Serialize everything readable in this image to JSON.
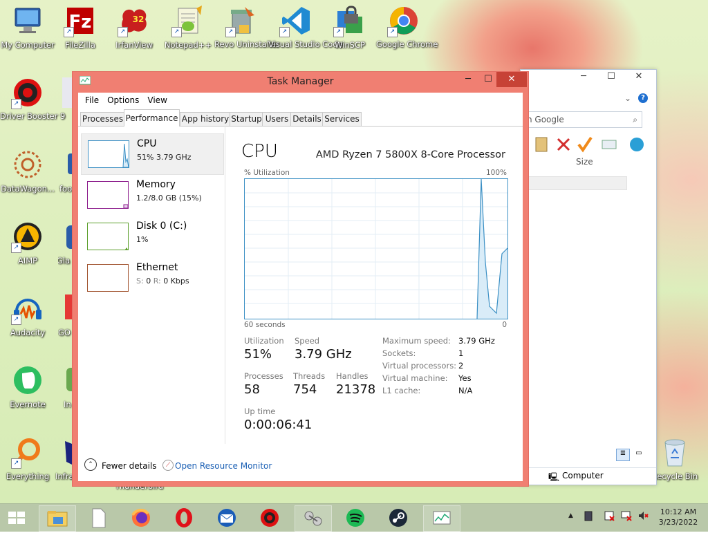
{
  "desktop": {
    "icons": [
      {
        "label": "My Computer",
        "icon": "computer-icon"
      },
      {
        "label": "FileZilla",
        "icon": "filezilla-icon"
      },
      {
        "label": "IrfanView",
        "icon": "irfanview-icon",
        "badge": "32"
      },
      {
        "label": "Notepad++",
        "icon": "notepad-plus-plus-icon"
      },
      {
        "label": "Revo Uninstaller",
        "icon": "revo-uninstaller-icon"
      },
      {
        "label": "Visual Studio Code",
        "icon": "vscode-icon"
      },
      {
        "label": "WinSCP",
        "icon": "winscp-icon"
      },
      {
        "label": "Google Chrome",
        "icon": "chrome-icon"
      },
      {
        "label": "Driver Booster 9",
        "icon": "driver-booster-icon"
      },
      {
        "label": "DataWagon...",
        "icon": "datawagon-icon"
      },
      {
        "label": "AIMP",
        "icon": "aimp-icon"
      },
      {
        "label": "Audacity",
        "icon": "audacity-icon"
      },
      {
        "label": "Evernote",
        "icon": "evernote-icon"
      },
      {
        "label": "Everything",
        "icon": "everything-icon"
      },
      {
        "label": "Recycle Bin",
        "icon": "recycle-bin-icon"
      }
    ],
    "partial_labels": {
      "col2_row2": "F",
      "col2_row3": "foo",
      "col2_row4": "Gla",
      "col2_row5": "GO",
      "col2_row6": "In",
      "col2_row7": "Infra",
      "thunderbird": "Thunderbird"
    }
  },
  "background_window": {
    "search_placeholder": "h Google",
    "column_size": "Size",
    "status_item": "Computer"
  },
  "task_manager": {
    "title": "Task Manager",
    "menu": [
      "File",
      "Options",
      "View"
    ],
    "tabs": [
      "Processes",
      "Performance",
      "App history",
      "Startup",
      "Users",
      "Details",
      "Services"
    ],
    "active_tab": "Performance",
    "resources": [
      {
        "name": "CPU",
        "detail": "51% 3.79 GHz",
        "color": "#3a8fc4"
      },
      {
        "name": "Memory",
        "detail": "1.2/8.0 GB (15%)",
        "color": "#8b1a8b"
      },
      {
        "name": "Disk 0 (C:)",
        "detail": "1%",
        "color": "#5a9e2a"
      },
      {
        "name": "Ethernet",
        "detail_parts": [
          "S:",
          "0",
          "R:",
          "0 Kbps"
        ],
        "color": "#a0522d"
      }
    ],
    "cpu": {
      "heading": "CPU",
      "model": "AMD Ryzen 7 5800X 8-Core Processor",
      "util_label": "% Utilization",
      "max_label": "100%",
      "time_label": "60 seconds",
      "min_label": "0",
      "utilization_label": "Utilization",
      "utilization": "51%",
      "speed_label": "Speed",
      "speed": "3.79 GHz",
      "processes_label": "Processes",
      "processes": "58",
      "threads_label": "Threads",
      "threads": "754",
      "handles_label": "Handles",
      "handles": "21378",
      "uptime_label": "Up time",
      "uptime": "0:00:06:41",
      "specs": [
        {
          "k": "Maximum speed:",
          "v": "3.79 GHz"
        },
        {
          "k": "Sockets:",
          "v": "1"
        },
        {
          "k": "Virtual processors:",
          "v": "2"
        },
        {
          "k": "Virtual machine:",
          "v": "Yes"
        },
        {
          "k": "L1 cache:",
          "v": "N/A"
        }
      ]
    },
    "footer": {
      "fewer": "Fewer details",
      "monitor": "Open Resource Monitor"
    }
  },
  "taskbar": {
    "time": "10:12 AM",
    "date": "3/23/2022",
    "apps": [
      "file-explorer-icon",
      "blank-document-icon",
      "firefox-icon",
      "opera-icon",
      "thunderbird-icon",
      "driver-booster-icon",
      "network-icon",
      "spotify-icon",
      "steam-icon",
      "task-manager-icon"
    ]
  }
}
